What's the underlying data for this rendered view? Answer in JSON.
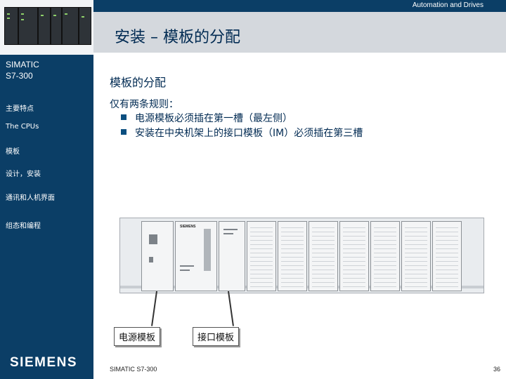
{
  "header": {
    "top_right": "Automation and Drives",
    "title": "安装 – 模板的分配"
  },
  "sidebar": {
    "title_line1": "SIMATIC",
    "title_line2": "S7-300",
    "items": [
      {
        "label": "主要特点"
      },
      {
        "label": "The CPUs"
      },
      {
        "label": "模板"
      },
      {
        "label": "设计，安装"
      },
      {
        "label": "通讯和人机界面"
      },
      {
        "label": "组态和编程"
      }
    ],
    "logo": "SIEMENS"
  },
  "main": {
    "subheading": "模板的分配",
    "rules_title": "仅有两条规则：",
    "bullets": [
      "电源模板必须插在第一槽（最左侧）",
      "安装在中央机架上的接口模板（IM）必须插在第三槽"
    ],
    "callouts": {
      "power_module": "电源模板",
      "interface_module": "接口模板"
    },
    "rack": {
      "cpu_brand": "SIEMENS"
    }
  },
  "footer": {
    "left": "SIMATIC S7-300",
    "page": "36"
  },
  "colors": {
    "sidebar": "#0b3e66",
    "title_band": "#d4d8dd",
    "text": "#002a52"
  }
}
